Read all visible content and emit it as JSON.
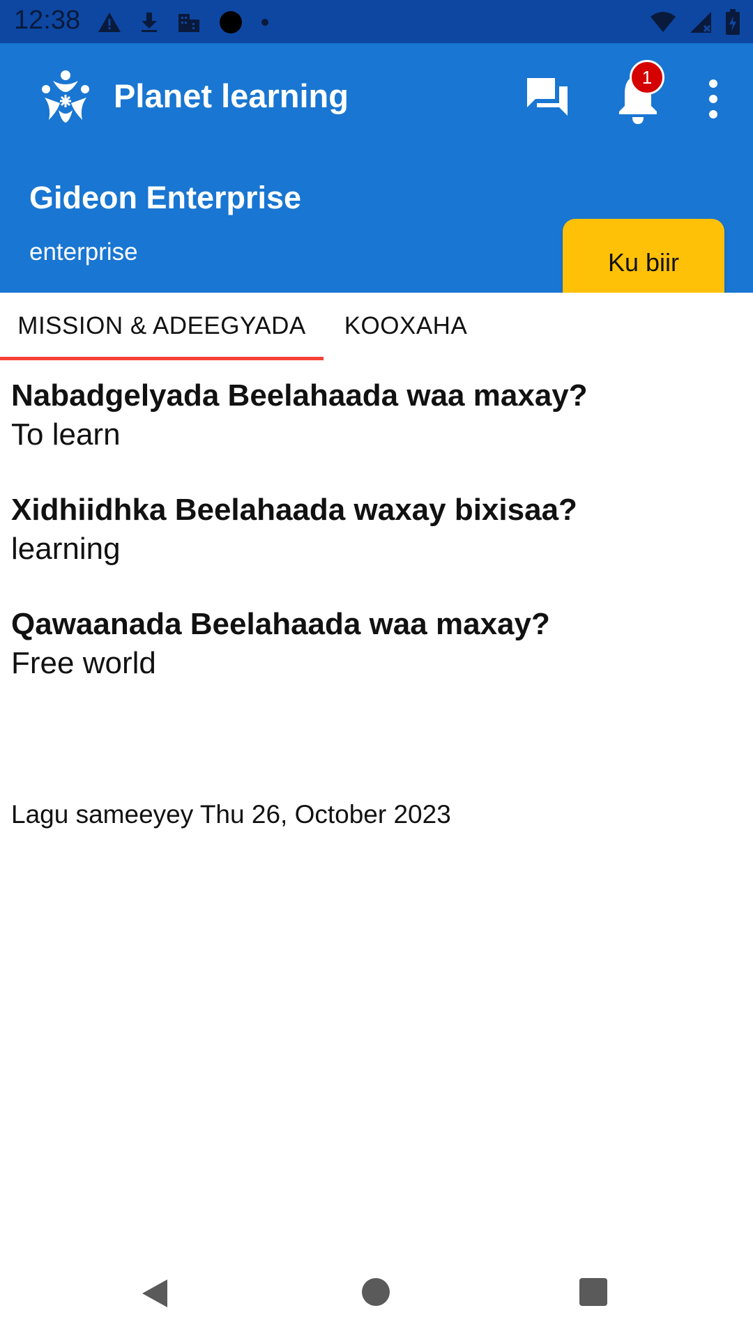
{
  "status_bar": {
    "time": "12:38",
    "left_icons": [
      "warning-icon",
      "download-icon",
      "building-icon",
      "circle-icon",
      "dot-icon"
    ],
    "right_icons": [
      "wifi-icon",
      "signal-icon",
      "battery-icon"
    ]
  },
  "app_bar": {
    "title": "Planet learning",
    "notification_count": "1",
    "colors": {
      "primary": "#1976d2",
      "status": "#0d47a1",
      "accent": "#ffc107",
      "badge": "#d50000"
    }
  },
  "team": {
    "name": "Gideon Enterprise",
    "type": "enterprise",
    "join_label": "Ku biir"
  },
  "tabs": [
    {
      "label": "MISSION & ADEEGYADA",
      "selected": true
    },
    {
      "label": "KOOXAHA",
      "selected": false
    }
  ],
  "content": {
    "items": [
      {
        "question": "Nabadgelyada Beelahaada waa maxay?",
        "answer": "To learn"
      },
      {
        "question": "Xidhiidhka Beelahaada waxay bixisaa?",
        "answer": "learning"
      },
      {
        "question": "Qawaanada Beelahaada waa maxay?",
        "answer": "Free world"
      }
    ],
    "created": "Lagu sameeyey Thu 26, October 2023"
  }
}
